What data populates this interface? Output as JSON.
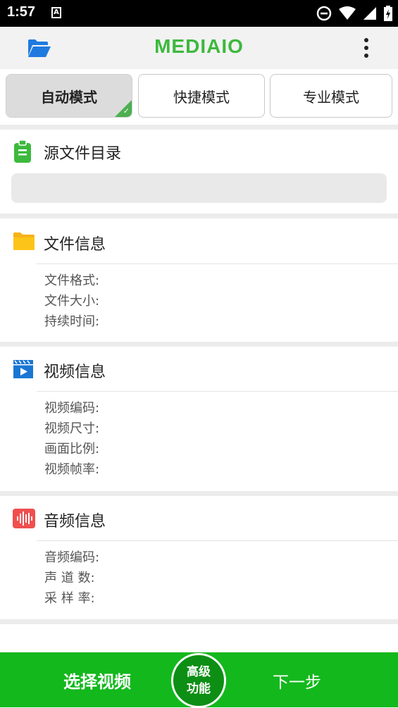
{
  "status_bar": {
    "time": "1:57",
    "notification_icon": "A"
  },
  "app_bar": {
    "logo": "MEDIAIO",
    "icons": [
      "folder-open-icon",
      "more-vert-icon"
    ]
  },
  "modes": [
    {
      "label": "自动模式",
      "selected": true
    },
    {
      "label": "快捷模式",
      "selected": false
    },
    {
      "label": "专业模式",
      "selected": false
    }
  ],
  "source_dir": {
    "title": "源文件目录",
    "path": ""
  },
  "file_info": {
    "title": "文件信息",
    "rows": [
      "文件格式:",
      "文件大小:",
      "持续时间:"
    ]
  },
  "video_info": {
    "title": "视频信息",
    "rows": [
      "视频编码:",
      "视频尺寸:",
      "画面比例:",
      "视频帧率:"
    ]
  },
  "audio_info": {
    "title": "音频信息",
    "rows": [
      "音频编码:",
      "声 道 数:",
      "采 样 率:"
    ]
  },
  "bottom": {
    "select_label": "选择视频",
    "advanced_label": [
      "高级",
      "功能"
    ],
    "next_label": "下一步"
  },
  "colors": {
    "accent_green": "#13b81d",
    "advanced_green": "#0c8f14",
    "logo_green": "#3db93d"
  }
}
